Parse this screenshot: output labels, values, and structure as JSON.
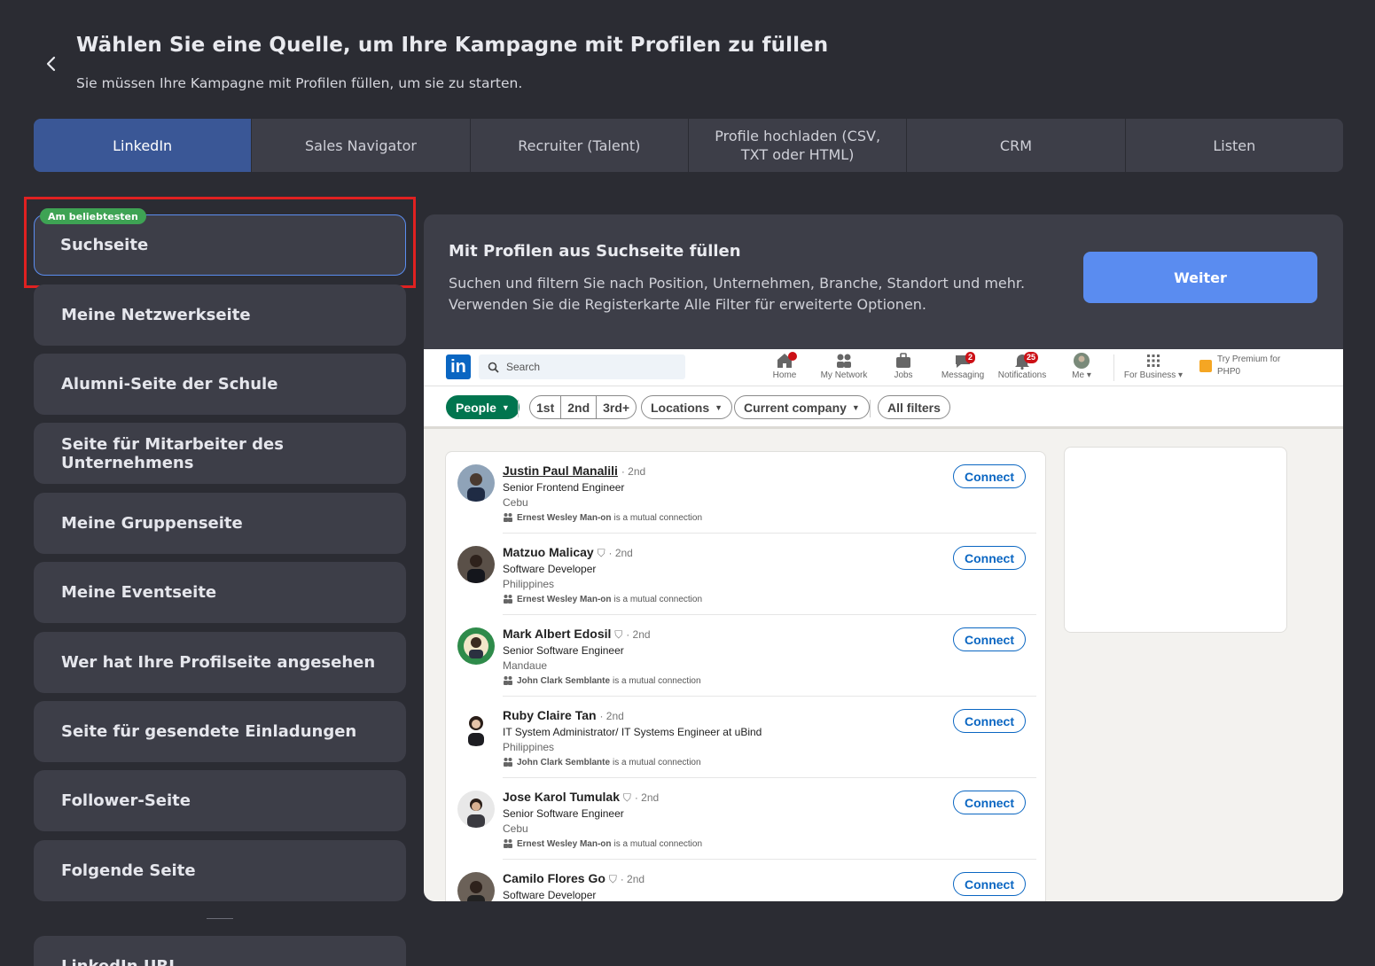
{
  "header": {
    "title": "Wählen Sie eine Quelle, um Ihre Kampagne mit Profilen zu füllen",
    "subtitle": "Sie müssen Ihre Kampagne mit Profilen füllen, um sie zu starten."
  },
  "tabs": [
    {
      "label": "LinkedIn",
      "active": true
    },
    {
      "label": "Sales Navigator"
    },
    {
      "label": "Recruiter (Talent)"
    },
    {
      "label": "Profile hochladen (CSV, TXT oder HTML)"
    },
    {
      "label": "CRM"
    },
    {
      "label": "Listen"
    }
  ],
  "sources": {
    "badge": "Am beliebtesten",
    "items": [
      "Suchseite",
      "Meine Netzwerkseite",
      "Alumni-Seite der Schule",
      "Seite für Mitarbeiter des Unternehmens",
      "Meine Gruppenseite",
      "Meine Eventseite",
      "Wer hat Ihre Profilseite angesehen",
      "Seite für gesendete Einladungen",
      "Follower-Seite",
      "Folgende Seite",
      "LinkedIn URL"
    ]
  },
  "panel": {
    "title": "Mit Profilen aus Suchseite füllen",
    "description": "Suchen und filtern Sie nach Position, Unternehmen, Branche, Standort und mehr. Verwenden Sie die Registerkarte Alle Filter für erweiterte Optionen.",
    "button": "Weiter"
  },
  "linkedin": {
    "logo": "in",
    "search_placeholder": "Search",
    "nav": [
      {
        "label": "Home",
        "icon": "home-icon"
      },
      {
        "label": "My Network",
        "icon": "network-icon"
      },
      {
        "label": "Jobs",
        "icon": "jobs-icon"
      },
      {
        "label": "Messaging",
        "icon": "messaging-icon",
        "badge": "2"
      },
      {
        "label": "Notifications",
        "icon": "bell-icon",
        "badge": "25"
      },
      {
        "label": "Me",
        "icon": "avatar-icon"
      },
      {
        "label": "For Business",
        "icon": "grid-icon"
      }
    ],
    "premium": "Try Premium for PHP0",
    "filters": {
      "people": "People",
      "degrees": [
        "1st",
        "2nd",
        "3rd+"
      ],
      "locations": "Locations",
      "company": "Current company",
      "all": "All filters"
    },
    "connect_label": "Connect",
    "mutual_suffix": "is a mutual connection",
    "results": [
      {
        "name": "Justin Paul Manalili",
        "degree": "· 2nd",
        "title": "Senior Frontend Engineer",
        "location": "Cebu",
        "mutual": "Ernest Wesley Man-on"
      },
      {
        "name": "Matzuo Malicay",
        "degree": "· 2nd",
        "title": "Software Developer",
        "location": "Philippines",
        "mutual": "Ernest Wesley Man-on"
      },
      {
        "name": "Mark Albert Edosil",
        "degree": "· 2nd",
        "title": "Senior Software Engineer",
        "location": "Mandaue",
        "mutual": "John Clark Semblante"
      },
      {
        "name": "Ruby Claire Tan",
        "degree": "· 2nd",
        "title": "IT System Administrator/ IT Systems Engineer at uBind",
        "location": "Philippines",
        "mutual": "John Clark Semblante"
      },
      {
        "name": "Jose Karol Tumulak",
        "degree": "· 2nd",
        "title": "Senior Software Engineer",
        "location": "Cebu",
        "mutual": "Ernest Wesley Man-on"
      },
      {
        "name": "Camilo Flores Go",
        "degree": "· 2nd",
        "title": "Software Developer",
        "location": "",
        "mutual": ""
      }
    ]
  },
  "colors": {
    "background": "#2b2c33",
    "card": "#3d3e48",
    "active_tab": "#3a5796",
    "accent": "#5a8cf0",
    "badge": "#3ea354",
    "highlight": "#e02121"
  }
}
